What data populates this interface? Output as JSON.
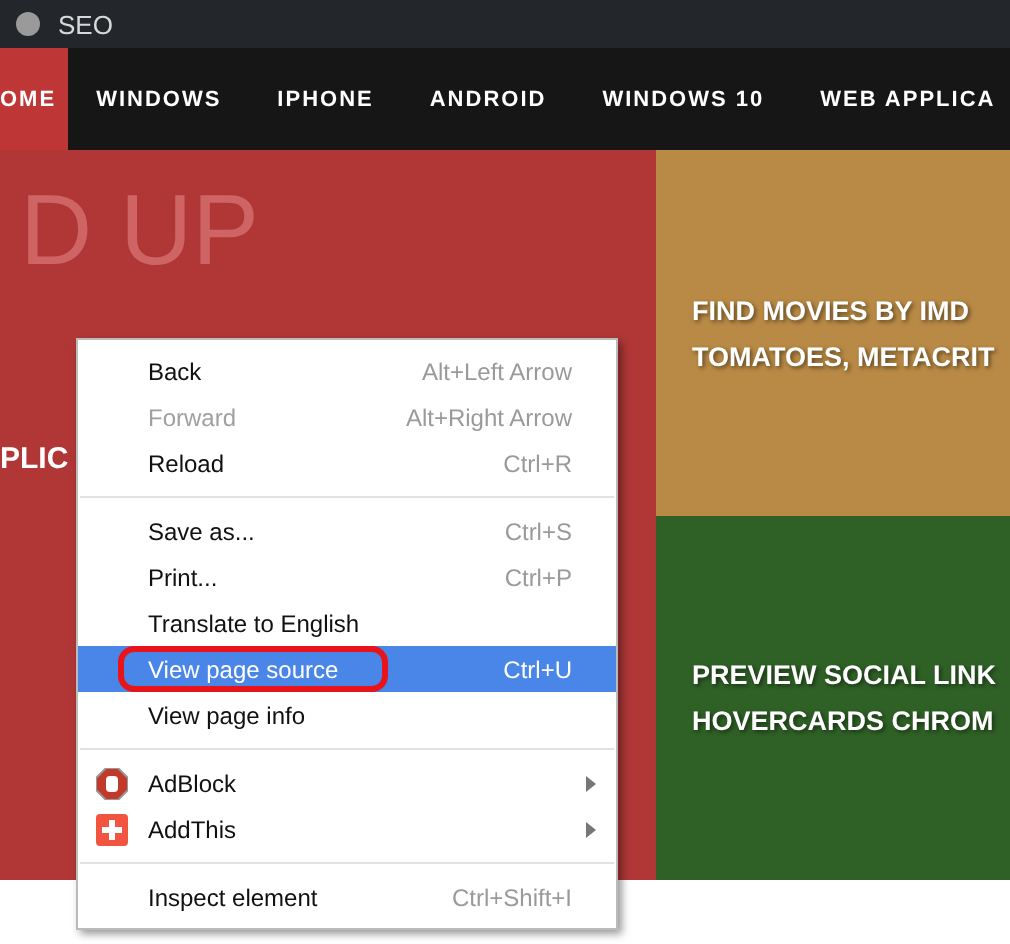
{
  "window": {
    "title": "SEO"
  },
  "nav": [
    {
      "label": "OME",
      "selected": true
    },
    {
      "label": "WINDOWS",
      "selected": false
    },
    {
      "label": "IPHONE",
      "selected": false
    },
    {
      "label": "ANDROID",
      "selected": false
    },
    {
      "label": "WINDOWS 10",
      "selected": false
    },
    {
      "label": "WEB APPLICA",
      "selected": false
    }
  ],
  "hero": {
    "faded_lines": [
      "D UP"
    ],
    "title_fragment": "PLIC"
  },
  "cards": [
    {
      "title_lines": [
        "FIND MOVIES BY IMD",
        "TOMATOES, METACRIT"
      ],
      "color": "#b98a45"
    },
    {
      "title_lines": [
        "PREVIEW SOCIAL LINK",
        "HOVERCARDS CHROM"
      ],
      "color": "#2f6126"
    }
  ],
  "context_menu": {
    "items": [
      {
        "kind": "command",
        "label": "Back",
        "shortcut": "Alt+Left Arrow",
        "disabled": false,
        "selected": false,
        "circled": false
      },
      {
        "kind": "command",
        "label": "Forward",
        "shortcut": "Alt+Right Arrow",
        "disabled": true,
        "selected": false,
        "circled": false
      },
      {
        "kind": "command",
        "label": "Reload",
        "shortcut": "Ctrl+R",
        "disabled": false,
        "selected": false,
        "circled": false
      },
      {
        "kind": "separator"
      },
      {
        "kind": "command",
        "label": "Save as...",
        "shortcut": "Ctrl+S",
        "disabled": false,
        "selected": false,
        "circled": false
      },
      {
        "kind": "command",
        "label": "Print...",
        "shortcut": "Ctrl+P",
        "disabled": false,
        "selected": false,
        "circled": false
      },
      {
        "kind": "command",
        "label": "Translate to English",
        "disabled": false,
        "selected": false,
        "circled": false
      },
      {
        "kind": "command",
        "label": "View page source",
        "shortcut": "Ctrl+U",
        "disabled": false,
        "selected": true,
        "circled": true
      },
      {
        "kind": "command",
        "label": "View page info",
        "disabled": false,
        "selected": false,
        "circled": false
      },
      {
        "kind": "separator"
      },
      {
        "kind": "extension",
        "label": "AdBlock"
      },
      {
        "kind": "extension",
        "label": "AddThis"
      },
      {
        "kind": "separator"
      },
      {
        "kind": "command",
        "label": "Inspect element",
        "shortcut": "Ctrl+Shift+I",
        "disabled": false,
        "selected": false,
        "circled": false
      }
    ]
  }
}
